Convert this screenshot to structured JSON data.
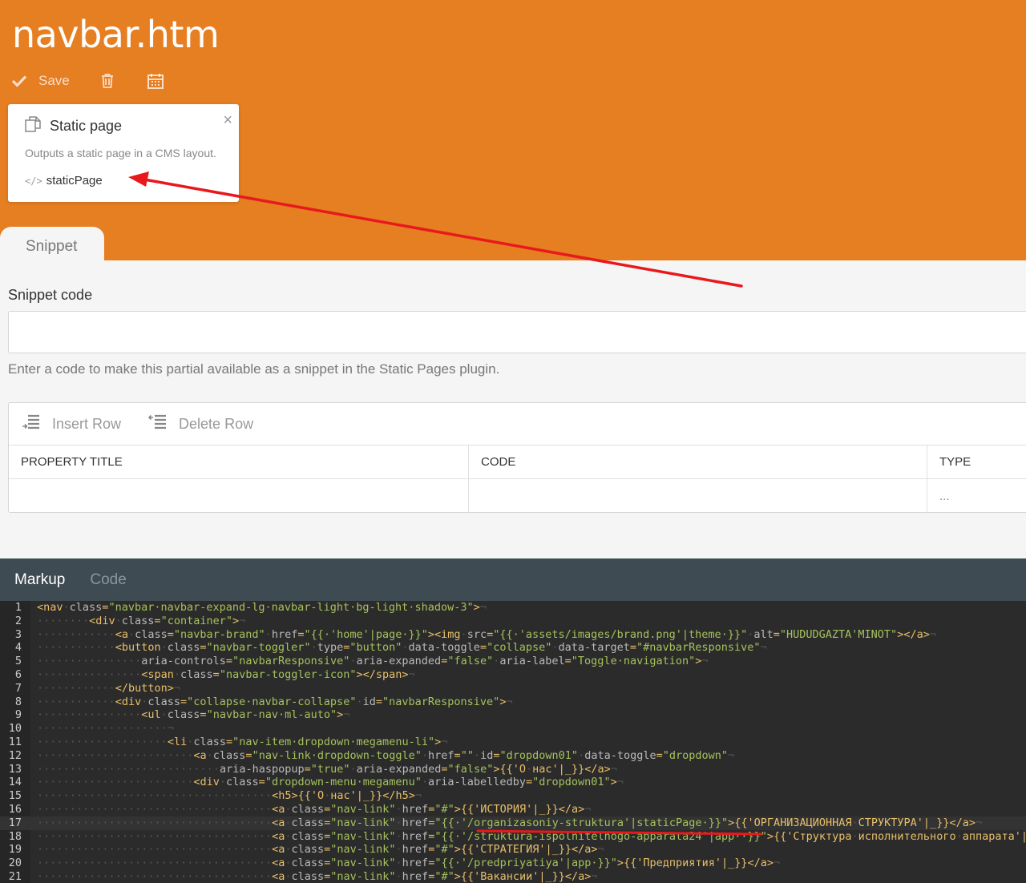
{
  "header": {
    "title": "navbar.htm",
    "save_label": "Save",
    "accent_color": "#e67e22"
  },
  "popover": {
    "title": "Static page",
    "description": "Outputs a static page in a CMS layout.",
    "code": "staticPage",
    "close_symbol": "×",
    "code_icon": "</>"
  },
  "tabs": {
    "primary": "Snippet"
  },
  "snippet": {
    "label": "Snippet code",
    "value": "",
    "help": "Enter a code to make this partial available as a snippet in the Static Pages plugin."
  },
  "grid": {
    "insert_label": "Insert Row",
    "delete_label": "Delete Row",
    "columns": [
      "PROPERTY TITLE",
      "CODE",
      "TYPE"
    ],
    "rows": [
      [
        "",
        "",
        "..."
      ]
    ]
  },
  "editor": {
    "tabs": [
      "Markup",
      "Code"
    ],
    "lines": [
      "<nav·class=\"navbar·navbar-expand-lg·navbar-light·bg-light·shadow-3\">¬",
      "········<div·class=\"container\">¬",
      "············<a·class=\"navbar-brand\"·href=\"{{·'home'|page·}}\"><img·src=\"{{·'assets/images/brand.png'|theme·}}\"·alt=\"HUDUDGAZTA'MINOT\"></a>¬",
      "············<button·class=\"navbar-toggler\"·type=\"button\"·data-toggle=\"collapse\"·data-target=\"#navbarResponsive\"¬",
      "················aria-controls=\"navbarResponsive\"·aria-expanded=\"false\"·aria-label=\"Toggle·navigation\">¬",
      "················<span·class=\"navbar-toggler-icon\"></span>¬",
      "············</button>¬",
      "············<div·class=\"collapse·navbar-collapse\"·id=\"navbarResponsive\">¬",
      "················<ul·class=\"navbar-nav·ml-auto\">¬",
      "····················¬",
      "····················<li·class=\"nav-item·dropdown·megamenu-li\">¬",
      "························<a·class=\"nav-link·dropdown-toggle\"·href=\"\"·id=\"dropdown01\"·data-toggle=\"dropdown\"¬",
      "····························aria-haspopup=\"true\"·aria-expanded=\"false\">{{'О·нас'|_}}</a>¬",
      "························<div·class=\"dropdown-menu·megamenu\"·aria-labelledby=\"dropdown01\">¬",
      "····································<h5>{{'О·нас'|_}}</h5>¬",
      "····································<a·class=\"nav-link\"·href=\"#\">{{'ИСТОРИЯ'|_}}</a>¬",
      "····································<a·class=\"nav-link\"·href=\"{{·'/organizasoniy-struktura'|staticPage·}}\">{{'ОРГАНИЗАЦИОННАЯ·СТРУКТУРА'|_}}</a>¬",
      "····································<a·class=\"nav-link\"·href=\"{{·'/struktura-ispolnitelnogo-apparata24'|app··}}\">{{'Структура·исполнительного·аппарата'|_}}</a>¬",
      "····································<a·class=\"nav-link\"·href=\"#\">{{'СТРАТЕГИЯ'|_}}</a>¬",
      "····································<a·class=\"nav-link\"·href=\"{{·'/predpriyatiya'|app·}}\">{{'Предприятия'|_}}</a>¬",
      "····································<a·class=\"nav-link\"·href=\"#\">{{'Вакансии'|_}}</a>¬"
    ],
    "current_line": 17
  }
}
